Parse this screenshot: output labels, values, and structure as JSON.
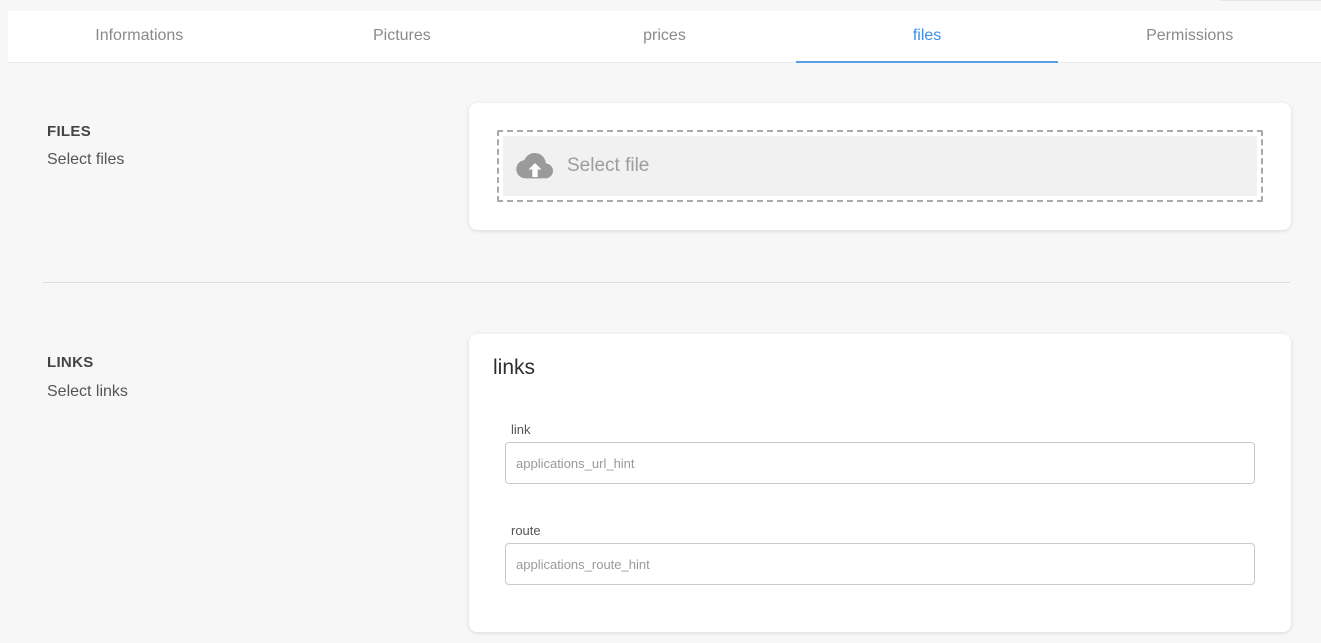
{
  "tabs": [
    {
      "label": "Informations",
      "active": false
    },
    {
      "label": "Pictures",
      "active": false
    },
    {
      "label": "prices",
      "active": false
    },
    {
      "label": "files",
      "active": true
    },
    {
      "label": "Permissions",
      "active": false
    }
  ],
  "files_section": {
    "title": "FILES",
    "subtitle": "Select files",
    "dropzone": {
      "icon": "cloud-upload-icon",
      "label": "Select file"
    }
  },
  "links_section": {
    "title": "LINKS",
    "subtitle": "Select links",
    "card_heading": "links",
    "fields": {
      "link": {
        "label": "link",
        "value": "",
        "placeholder": "applications_url_hint"
      },
      "route": {
        "label": "route",
        "value": "",
        "placeholder": "applications_route_hint"
      }
    }
  },
  "colors": {
    "accent": "#3d8ee6",
    "background": "#f7f7f7",
    "card": "#ffffff"
  }
}
